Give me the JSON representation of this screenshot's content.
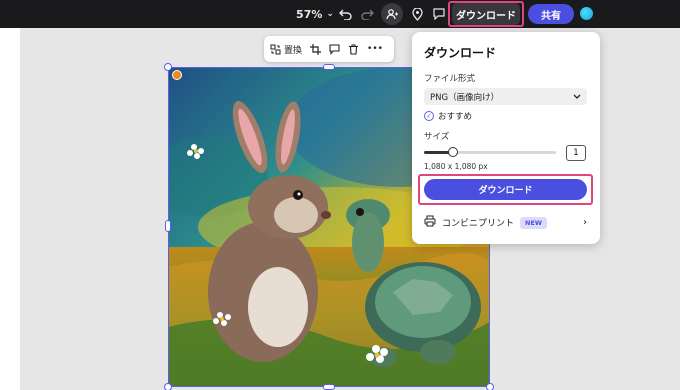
{
  "topbar": {
    "zoom": "57%",
    "download_label": "ダウンロード",
    "share_label": "共有"
  },
  "context_toolbar": {
    "replace_label": "置換",
    "more_label": "•••"
  },
  "panel": {
    "title": "ダウンロード",
    "file_format_label": "ファイル形式",
    "file_format_value": "PNG（画像向け）",
    "recommended_label": "おすすめ",
    "size_label": "サイズ",
    "size_slider_level": 0.22,
    "quantity": "1",
    "dimensions": "1,080 x 1,080 px",
    "download_button": "ダウンロード",
    "convenience_print_label": "コンビニプリント",
    "new_badge": "NEW"
  },
  "colors": {
    "accent": "#4b4fe0",
    "highlight": "#e0457f",
    "topbar": "#1a1a1c"
  },
  "icons": [
    "undo-icon",
    "redo-icon",
    "invite-person-icon",
    "location-pin-icon",
    "comment-icon",
    "avatar-icon",
    "replace-icon",
    "crop-icon",
    "comment-icon",
    "trash-icon",
    "more-icon",
    "check-icon",
    "chevron-down-icon",
    "print-icon",
    "chevron-right-icon",
    "ai-badge-icon"
  ]
}
